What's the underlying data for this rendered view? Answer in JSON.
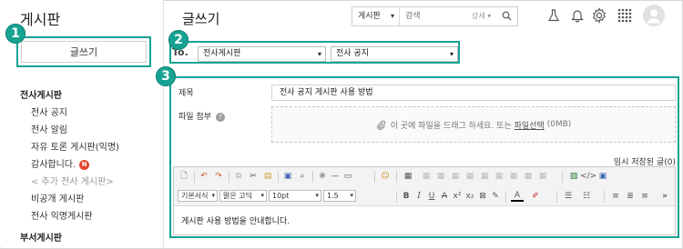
{
  "sidebar": {
    "title": "게시판",
    "write_button": "글쓰기",
    "groups": [
      {
        "heading": "전사게시판"
      },
      {
        "heading": "부서게시판"
      }
    ],
    "items": [
      {
        "label": "전사 공지"
      },
      {
        "label": "전사 알림"
      },
      {
        "label": "자유 토론 게시판(익명)"
      },
      {
        "label": "감사합니다.",
        "badge": "N"
      },
      {
        "label": "< 추가 전사 게시판>"
      },
      {
        "label": "비공개 게시판"
      },
      {
        "label": "전사 익명게시판"
      }
    ]
  },
  "header": {
    "title": "글쓰기",
    "search": {
      "scope": "게시판",
      "placeholder": "검색",
      "advanced": "상세"
    },
    "icons": [
      "flask-icon",
      "bell-icon",
      "gear-icon",
      "apps-grid-icon",
      "avatar"
    ]
  },
  "callouts": [
    "1",
    "2",
    "3"
  ],
  "target": {
    "label": "To.",
    "board": "전사게시판",
    "category": "전사 공지"
  },
  "form": {
    "subject_label": "제목",
    "subject_value": "전사 공지 게시판 사용 방법",
    "attach_label": "파일 첨부",
    "attach_help": "?",
    "drop_text": "이 곳에 파일을 드래그 하세요. 또는",
    "drop_link": "파일선택",
    "drop_size": "(0MB)",
    "autosave": "임시 저장된 글(0)"
  },
  "editor": {
    "format": "기본서식",
    "font": "맑은 고딕",
    "size": "10pt",
    "line_height": "1.5",
    "content": "게시판 사용 방법을 안내합니다."
  },
  "colors": {
    "accent": "#17a393",
    "new_badge": "#e5432f"
  }
}
